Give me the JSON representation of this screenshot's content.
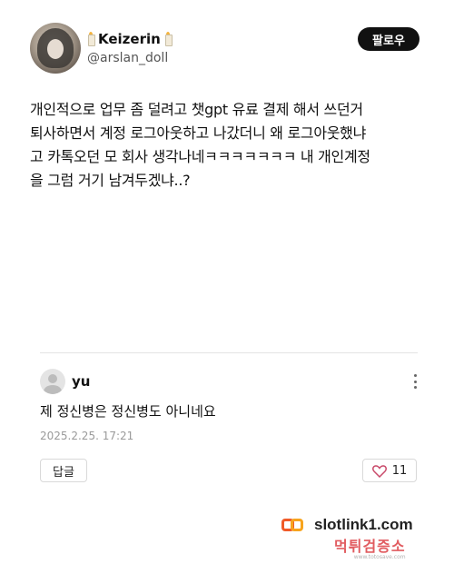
{
  "post": {
    "author_name": "Keizerin",
    "author_handle": "@arslan_doll",
    "follow_label": "팔로우",
    "body": "개인적으로 업무 좀 덜려고 챗gpt 유료 결제 해서 쓰던거\n퇴사하면서 계정 로그아웃하고 나갔더니 왜 로그아웃했냐\n고 카톡오던 모 회사 생각나네ㅋㅋㅋㅋㅋㅋㅋ 내 개인계정\n을 그럼 거기 남겨두겠냐..?"
  },
  "comment": {
    "username": "yu",
    "text": "제 정신병은 정신병도 아니네요",
    "date": "2025.2.25. 17:21",
    "reply_label": "답글",
    "like_count": "11"
  },
  "watermarks": {
    "site": "slotlink1.com",
    "brand": "먹튀검증소",
    "brand_small": "www.totosave.com"
  },
  "colors": {
    "follow_button_bg": "#111111",
    "like_heart": "#c94a6a",
    "watermark_orange": "#f05a28",
    "watermark_red": "#d8262c"
  },
  "icons": {
    "candle": "candle-icon",
    "more": "more-vertical-icon",
    "heart": "heart-outline-icon",
    "avatar_placeholder": "user-placeholder-icon"
  }
}
